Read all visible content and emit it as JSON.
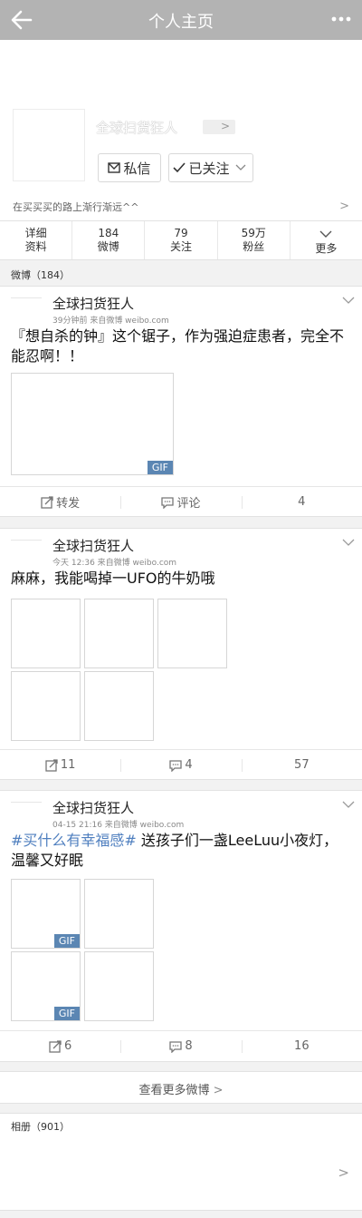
{
  "header": {
    "title": "个人主页",
    "back_icon": "back-arrow-icon",
    "more_icon": "more-dots-icon"
  },
  "profile": {
    "name": "全球扫货狂人",
    "message_label": "私信",
    "follow_label": "已关注",
    "bio": "在买买买的路上渐行渐远^^"
  },
  "stats": [
    {
      "top": "详细",
      "bottom": "资料"
    },
    {
      "top": "184",
      "bottom": "微博"
    },
    {
      "top": "79",
      "bottom": "关注"
    },
    {
      "top": "59万",
      "bottom": "粉丝"
    },
    {
      "top": "",
      "bottom": "更多"
    }
  ],
  "weibo_header": "微博（184）",
  "posts": [
    {
      "author": "全球扫货狂人",
      "meta": "39分钟前   来自微博 weibo.com",
      "text": "『想自杀的钟』这个锯子，作为强迫症患者，完全不能忍啊！！",
      "repost": "转发",
      "comment": "评论",
      "likes": "4"
    },
    {
      "author": "全球扫货狂人",
      "meta": "今天 12:36   来自微博 weibo.com",
      "text": "麻麻，我能喝掉一UFO的牛奶哦",
      "repost": "11",
      "comment": "4",
      "likes": "57"
    },
    {
      "author": "全球扫货狂人",
      "meta": "04-15 21:16   来自微博 weibo.com",
      "tag": "#买什么有幸福感#",
      "text": " 送孩子们一盏LeeLuu小夜灯，温馨又好眠",
      "repost": "6",
      "comment": "8",
      "likes": "16"
    }
  ],
  "gif_label": "GIF",
  "more_weibo": "查看更多微博",
  "album_title": "相册（901）"
}
